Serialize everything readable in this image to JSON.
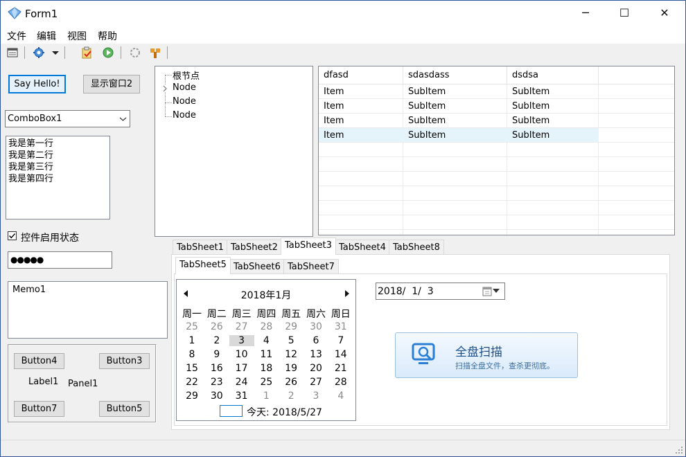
{
  "window": {
    "title": "Form1",
    "minimize": "─",
    "maximize": "☐",
    "close": "✕"
  },
  "menu": [
    "文件",
    "编辑",
    "视图",
    "帮助"
  ],
  "toolbar": {
    "icons": [
      "window-icon",
      "gear-icon",
      "dropdown-arrow-icon",
      "checklist-icon",
      "play-icon",
      "spinner-icon",
      "tools-icon"
    ]
  },
  "buttons": {
    "say_hello": "Say Hello!",
    "show_window2": "显示窗口2"
  },
  "combo": {
    "value": "ComboBox1"
  },
  "listbox": [
    "我是第一行",
    "我是第二行",
    "我是第三行",
    "我是第四行"
  ],
  "checkbox": {
    "label": "控件启用状态",
    "checked": true
  },
  "password": {
    "value": "●●●●●"
  },
  "memo": {
    "value": "Memo1"
  },
  "panel": {
    "button4": "Button4",
    "button3": "Button3",
    "label1": "Label1",
    "panel1": "Panel1",
    "button7": "Button7",
    "button5": "Button5"
  },
  "tree": {
    "root": "根节点",
    "nodes": [
      "Node",
      "Node",
      "Node"
    ]
  },
  "listview": {
    "columns": [
      "dfasd",
      "sdasdass",
      "dsdsa"
    ],
    "rows": [
      [
        "Item",
        "SubItem",
        "SubItem"
      ],
      [
        "Item",
        "SubItem",
        "SubItem"
      ],
      [
        "Item",
        "SubItem",
        "SubItem"
      ],
      [
        "Item",
        "SubItem",
        "SubItem"
      ]
    ]
  },
  "tabs_outer": [
    "TabSheet1",
    "TabSheet2",
    "TabSheet3",
    "TabSheet4",
    "TabSheet8"
  ],
  "tabs_inner": [
    "TabSheet5",
    "TabSheet6",
    "TabSheet7"
  ],
  "calendar": {
    "month_label": "2018年1月",
    "weekdays": [
      "周一",
      "周二",
      "周三",
      "周四",
      "周五",
      "周六",
      "周日"
    ],
    "weeks": [
      [
        "25",
        "26",
        "27",
        "28",
        "29",
        "30",
        "31"
      ],
      [
        "1",
        "2",
        "3",
        "4",
        "5",
        "6",
        "7"
      ],
      [
        "8",
        "9",
        "10",
        "11",
        "12",
        "13",
        "14"
      ],
      [
        "15",
        "16",
        "17",
        "18",
        "19",
        "20",
        "21"
      ],
      [
        "22",
        "23",
        "24",
        "25",
        "26",
        "27",
        "28"
      ],
      [
        "29",
        "30",
        "31",
        "1",
        "2",
        "3",
        "4"
      ]
    ],
    "selected_day": "3",
    "today_label": "今天: 2018/5/27"
  },
  "date_picker": {
    "value": "2018/  1/  3"
  },
  "scan_button": {
    "title": "全盘扫描",
    "subtitle": "扫描全盘文件，查杀更彻底。"
  }
}
